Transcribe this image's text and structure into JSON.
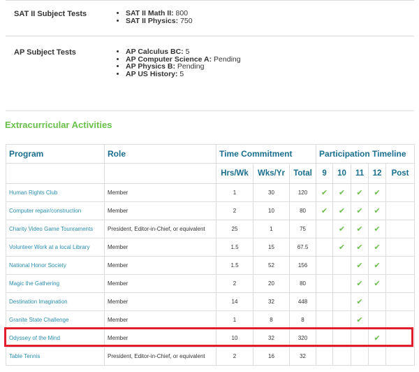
{
  "test_scores": [
    {
      "label": "SAT II Subject Tests",
      "items": [
        {
          "name": "SAT II Math II:",
          "value": " 800"
        },
        {
          "name": "SAT II Physics:",
          "value": " 750"
        }
      ]
    },
    {
      "label": "AP Subject Tests",
      "items": [
        {
          "name": "AP Calculus BC:",
          "value": " 5"
        },
        {
          "name": "AP Computer Science A:",
          "value": " Pending"
        },
        {
          "name": "AP Physics B:",
          "value": " Pending"
        },
        {
          "name": "AP US History:",
          "value": " 5"
        }
      ]
    }
  ],
  "extracurricular": {
    "title": "Extracurricular Activities",
    "headers": {
      "program": "Program",
      "role": "Role",
      "time_commitment": "Time Commitment",
      "participation_timeline": "Participation Timeline",
      "hrs_wk": "Hrs/Wk",
      "wks_yr": "Wks/Yr",
      "total": "Total",
      "grades": [
        "9",
        "10",
        "11",
        "12",
        "Post"
      ]
    },
    "check_glyph": "✔",
    "check_color": "#6abf4b",
    "highlight_color": "#e31d2b",
    "rows": [
      {
        "program": "Human Rights Club",
        "role": "Member",
        "hrs": "1",
        "wks": "30",
        "total": "120",
        "grades": [
          true,
          true,
          true,
          true,
          false
        ]
      },
      {
        "program": "Computer repair/construction",
        "role": "Member",
        "hrs": "2",
        "wks": "10",
        "total": "80",
        "grades": [
          true,
          true,
          true,
          true,
          false
        ]
      },
      {
        "program": "Charity Video Game Tounraments",
        "role": "President, Editor-in-Chief, or equivalent",
        "hrs": "25",
        "wks": "1",
        "total": "75",
        "grades": [
          false,
          true,
          true,
          true,
          false
        ]
      },
      {
        "program": "Volunteer Work at a local Library",
        "role": "Member",
        "hrs": "1.5",
        "wks": "15",
        "total": "67.5",
        "grades": [
          false,
          true,
          true,
          true,
          false
        ]
      },
      {
        "program": "National Honor Society",
        "role": "Member",
        "hrs": "1.5",
        "wks": "52",
        "total": "156",
        "grades": [
          false,
          false,
          true,
          true,
          false
        ]
      },
      {
        "program": "Magic the Gathering",
        "role": "Member",
        "hrs": "2",
        "wks": "20",
        "total": "80",
        "grades": [
          false,
          false,
          true,
          true,
          false
        ]
      },
      {
        "program": "Destination Imagination",
        "role": "Member",
        "hrs": "14",
        "wks": "32",
        "total": "448",
        "grades": [
          false,
          false,
          true,
          false,
          false
        ]
      },
      {
        "program": "Granite State Challenge",
        "role": "Member",
        "hrs": "1",
        "wks": "8",
        "total": "8",
        "grades": [
          false,
          false,
          true,
          false,
          false
        ]
      },
      {
        "program": "Odyssey of the Mind",
        "role": "Member",
        "hrs": "10",
        "wks": "32",
        "total": "320",
        "grades": [
          false,
          false,
          false,
          true,
          false
        ],
        "highlighted": true
      },
      {
        "program": "Table Tennis",
        "role": "President, Editor-in-Chief, or equivalent",
        "hrs": "2",
        "wks": "16",
        "total": "32",
        "grades": [
          false,
          false,
          false,
          false,
          false
        ]
      }
    ]
  }
}
